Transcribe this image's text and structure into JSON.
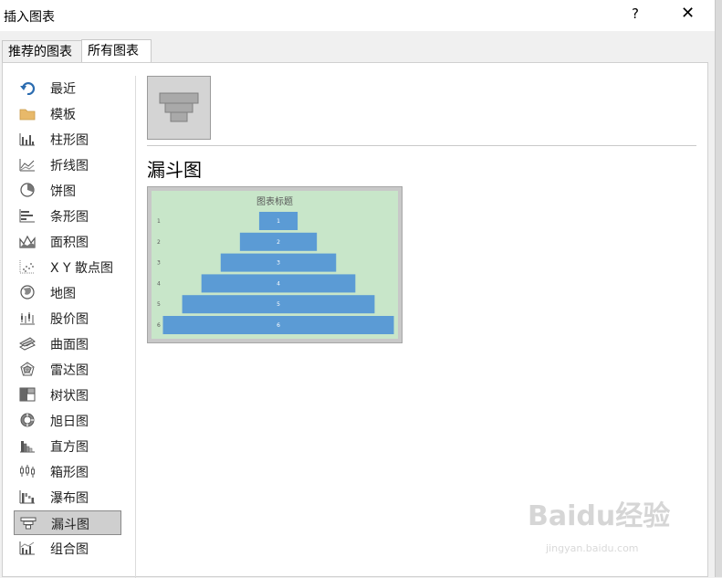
{
  "window": {
    "title": "插入图表",
    "help_label": "?",
    "close_label": "✕"
  },
  "tabs": [
    {
      "label": "推荐的图表"
    },
    {
      "label": "所有图表"
    }
  ],
  "sidebar": {
    "items": [
      {
        "label": "最近",
        "icon": "recent-icon"
      },
      {
        "label": "模板",
        "icon": "folder-icon"
      },
      {
        "label": "柱形图",
        "icon": "column-chart-icon"
      },
      {
        "label": "折线图",
        "icon": "line-chart-icon"
      },
      {
        "label": "饼图",
        "icon": "pie-chart-icon"
      },
      {
        "label": "条形图",
        "icon": "bar-chart-icon"
      },
      {
        "label": "面积图",
        "icon": "area-chart-icon"
      },
      {
        "label": "X Y 散点图",
        "icon": "scatter-chart-icon"
      },
      {
        "label": "地图",
        "icon": "globe-icon"
      },
      {
        "label": "股价图",
        "icon": "stock-chart-icon"
      },
      {
        "label": "曲面图",
        "icon": "surface-chart-icon"
      },
      {
        "label": "雷达图",
        "icon": "radar-chart-icon"
      },
      {
        "label": "树状图",
        "icon": "treemap-icon"
      },
      {
        "label": "旭日图",
        "icon": "sunburst-icon"
      },
      {
        "label": "直方图",
        "icon": "histogram-icon"
      },
      {
        "label": "箱形图",
        "icon": "box-whisker-icon"
      },
      {
        "label": "瀑布图",
        "icon": "waterfall-icon"
      },
      {
        "label": "漏斗图",
        "icon": "funnel-icon",
        "selected": true
      },
      {
        "label": "组合图",
        "icon": "combo-chart-icon"
      }
    ]
  },
  "main": {
    "chart_type_title": "漏斗图"
  },
  "chart_data": {
    "type": "bar",
    "subtype": "funnel",
    "title": "图表标题",
    "categories": [
      "1",
      "2",
      "3",
      "4",
      "5",
      "6"
    ],
    "values": [
      1,
      2,
      3,
      4,
      5,
      6
    ],
    "colors": {
      "plot_bg": "#c8e6c9",
      "bar": "#5b9bd5",
      "label": "#ffffff"
    }
  },
  "watermark": {
    "logo": "Baidu经验",
    "url": "jingyan.baidu.com"
  }
}
